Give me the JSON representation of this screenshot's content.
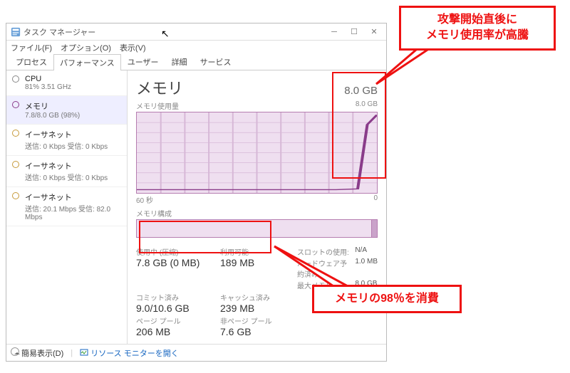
{
  "window": {
    "title": "タスク マネージャー",
    "menu": {
      "file": "ファイル(F)",
      "options": "オプション(O)",
      "view": "表示(V)"
    },
    "tabs": [
      "プロセス",
      "パフォーマンス",
      "ユーザー",
      "詳細",
      "サービス"
    ],
    "active_tab": 1
  },
  "sidebar": {
    "items": [
      {
        "name": "CPU",
        "sub": "81%  3.51 GHz"
      },
      {
        "name": "メモリ",
        "sub": "7.8/8.0 GB (98%)"
      },
      {
        "name": "イーサネット",
        "sub": "送信: 0 Kbps 受信: 0 Kbps"
      },
      {
        "name": "イーサネット",
        "sub": "送信: 0 Kbps 受信: 0 Kbps"
      },
      {
        "name": "イーサネット",
        "sub": "送信: 20.1 Mbps 受信: 82.0 Mbps"
      }
    ],
    "selected": 1
  },
  "memory": {
    "title": "メモリ",
    "total": "8.0 GB",
    "usage_label": "メモリ使用量",
    "usage_max": "8.0 GB",
    "axis_left": "60 秒",
    "axis_right": "0",
    "composition_label": "メモリ構成",
    "stats": {
      "in_use_label": "使用中 (圧縮)",
      "in_use_value": "7.8 GB (0 MB)",
      "available_label": "利用可能",
      "available_value": "189 MB",
      "committed_label": "コミット済み",
      "committed_value": "9.0/10.6 GB",
      "cached_label": "キャッシュ済み",
      "cached_value": "239 MB",
      "paged_label": "ページ プール",
      "paged_value": "206 MB",
      "nonpaged_label": "非ページ プール",
      "nonpaged_value": "7.6 GB"
    },
    "alloc": {
      "slots_label": "スロットの使用:",
      "slots_value": "N/A",
      "hw_label": "ハードウェア予約済み:",
      "hw_value": "1.0 MB",
      "max_label": "最大メモリ:",
      "max_value": "8.0 GB"
    }
  },
  "footer": {
    "simple_view": "簡易表示(D)",
    "resource_monitor": "リソース モニターを開く"
  },
  "callouts": {
    "c1_line1": "攻撃開始直後に",
    "c1_line2": "メモリ使用率が高騰",
    "c2": "メモリの98％を消費"
  },
  "chart_data": {
    "type": "line",
    "title": "メモリ使用量",
    "xlabel": "秒",
    "ylabel": "GB",
    "x_range": [
      60,
      0
    ],
    "ylim": [
      0,
      8.0
    ],
    "series": [
      {
        "name": "使用中",
        "x": [
          60,
          10,
          5,
          2,
          0
        ],
        "values": [
          0.3,
          0.3,
          0.4,
          7.0,
          7.8
        ]
      }
    ]
  }
}
